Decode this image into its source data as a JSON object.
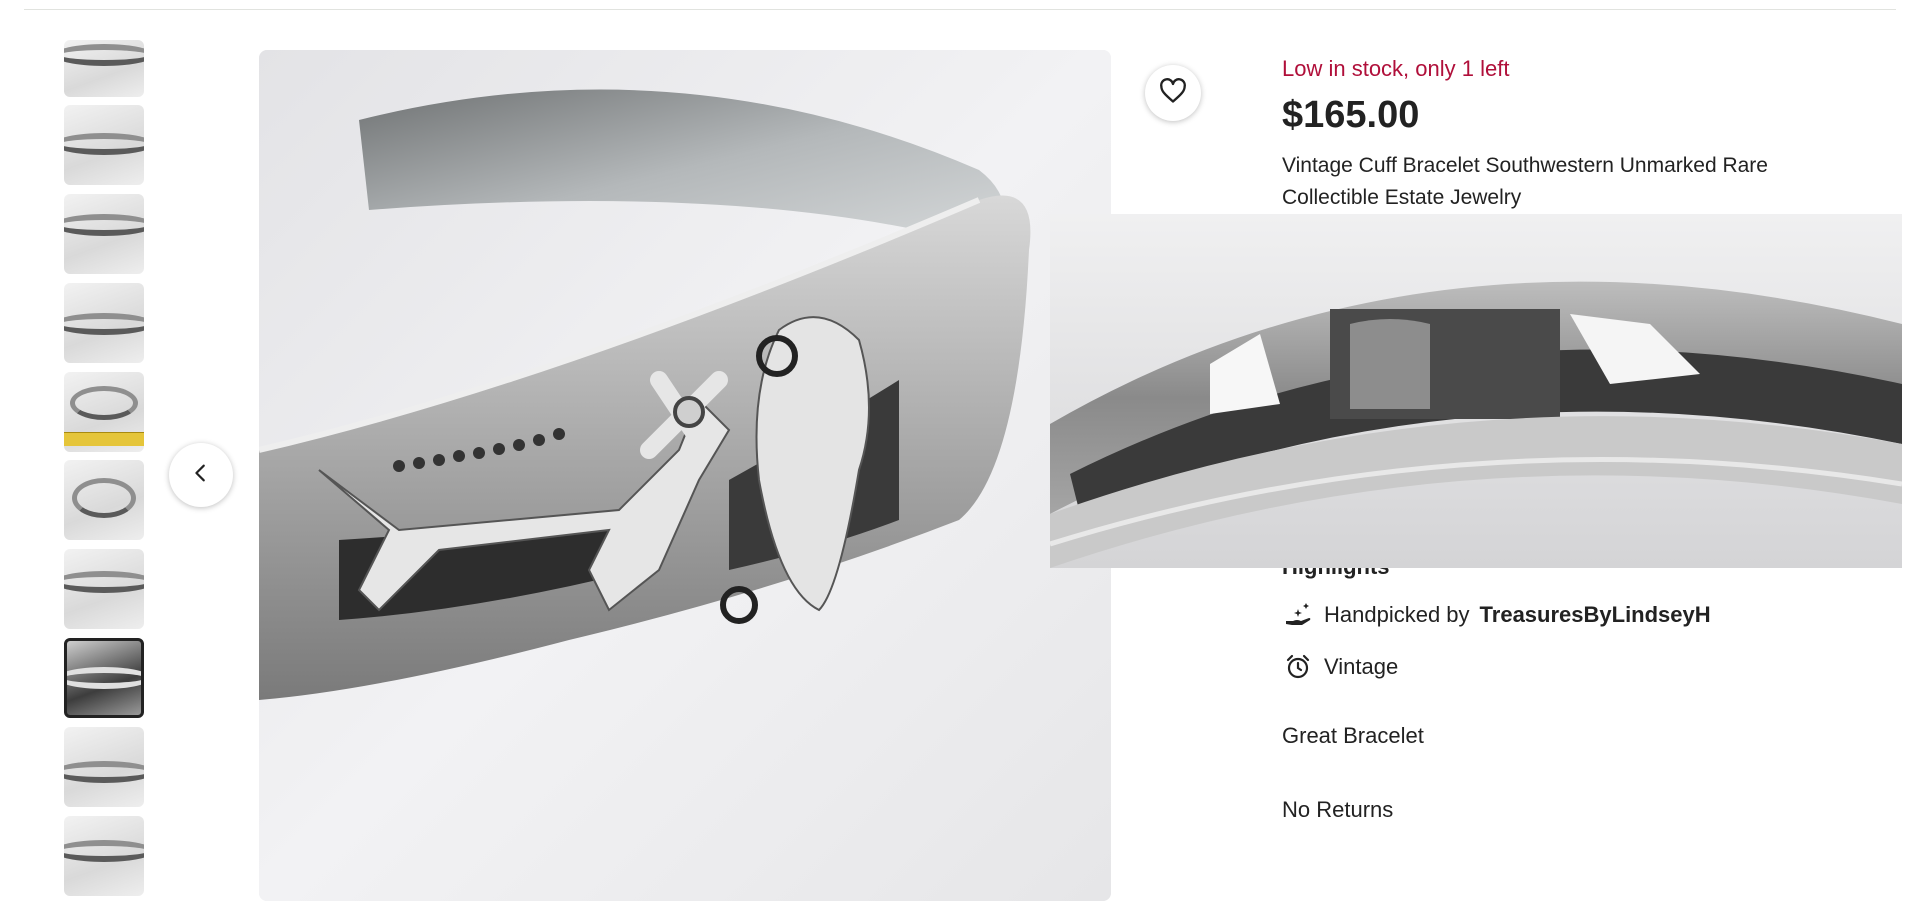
{
  "listing": {
    "stock_message": "Low in stock, only 1 left",
    "price": "$165.00",
    "title": "Vintage Cuff Bracelet Southwestern Unmarked Rare Collectible Estate Jewelry"
  },
  "highlights": {
    "heading": "Highlights",
    "handpicked_prefix": "Handpicked by",
    "shop_name": "TreasuresByLindseyH",
    "vintage_label": "Vintage"
  },
  "notes": {
    "line1": "Great Bracelet",
    "line2": "No Returns"
  },
  "icons": {
    "favorite": "heart-icon",
    "previous": "chevron-left-icon",
    "handpicked": "hand-sparkle-icon",
    "vintage": "alarm-clock-icon"
  },
  "gallery": {
    "thumbnail_count": 10,
    "selected_index": 7
  },
  "colors": {
    "stock_red": "#b00f3a",
    "text": "#222222"
  }
}
